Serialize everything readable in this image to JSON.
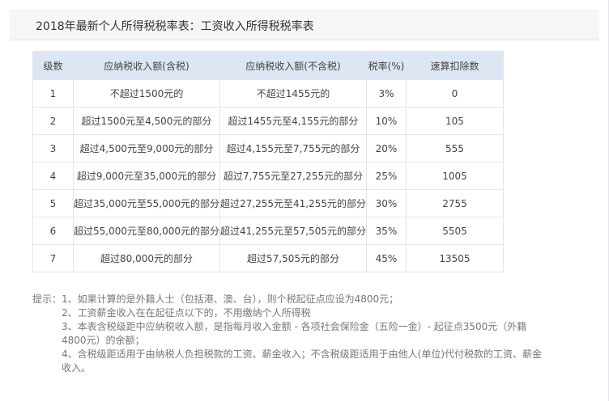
{
  "title": "2018年最新个人所得税税率表：工资收入所得税税率表",
  "table": {
    "headers": [
      "级数",
      "应纳税收入额(含税)",
      "应纳税收入额(不含税)",
      "税率(%)",
      "速算扣除数"
    ],
    "rows": [
      [
        "1",
        "不超过1500元的",
        "不超过1455元的",
        "3%",
        "0"
      ],
      [
        "2",
        "超过1500元至4,500元的部分",
        "超过1455元至4,155元的部分",
        "10%",
        "105"
      ],
      [
        "3",
        "超过4,500元至9,000元的部分",
        "超过4,155元至7,755元的部分",
        "20%",
        "555"
      ],
      [
        "4",
        "超过9,000元至35,000元的部分",
        "超过7,755元至27,255元的部分",
        "25%",
        "1005"
      ],
      [
        "5",
        "超过35,000元至55,000元的部分",
        "超过27,255元至41,255元的部分",
        "30%",
        "2755"
      ],
      [
        "6",
        "超过55,000元至80,000元的部分",
        "超过41,255元至57,505元的部分",
        "35%",
        "5505"
      ],
      [
        "7",
        "超过80,000元的部分",
        "超过57,505元的部分",
        "45%",
        "13505"
      ]
    ]
  },
  "notes": {
    "prefix": "提示：",
    "items": [
      "1、如果计算的是外籍人士（包括港、澳、台），则个税起征点应设为4800元；",
      "2、工资薪金收入在在起征点以下的，不用缴纳个人所得税",
      "3、本表含税级距中应纳税收入额，是指每月收入金额 - 各项社会保险金（五险一金）- 起征点3500元（外籍4800元）的余额；",
      "4、含税级距适用于由纳税人负担税款的工资、薪金收入；不含税级距适用于由他人(单位)代付税款的工资、薪金收入。"
    ]
  }
}
